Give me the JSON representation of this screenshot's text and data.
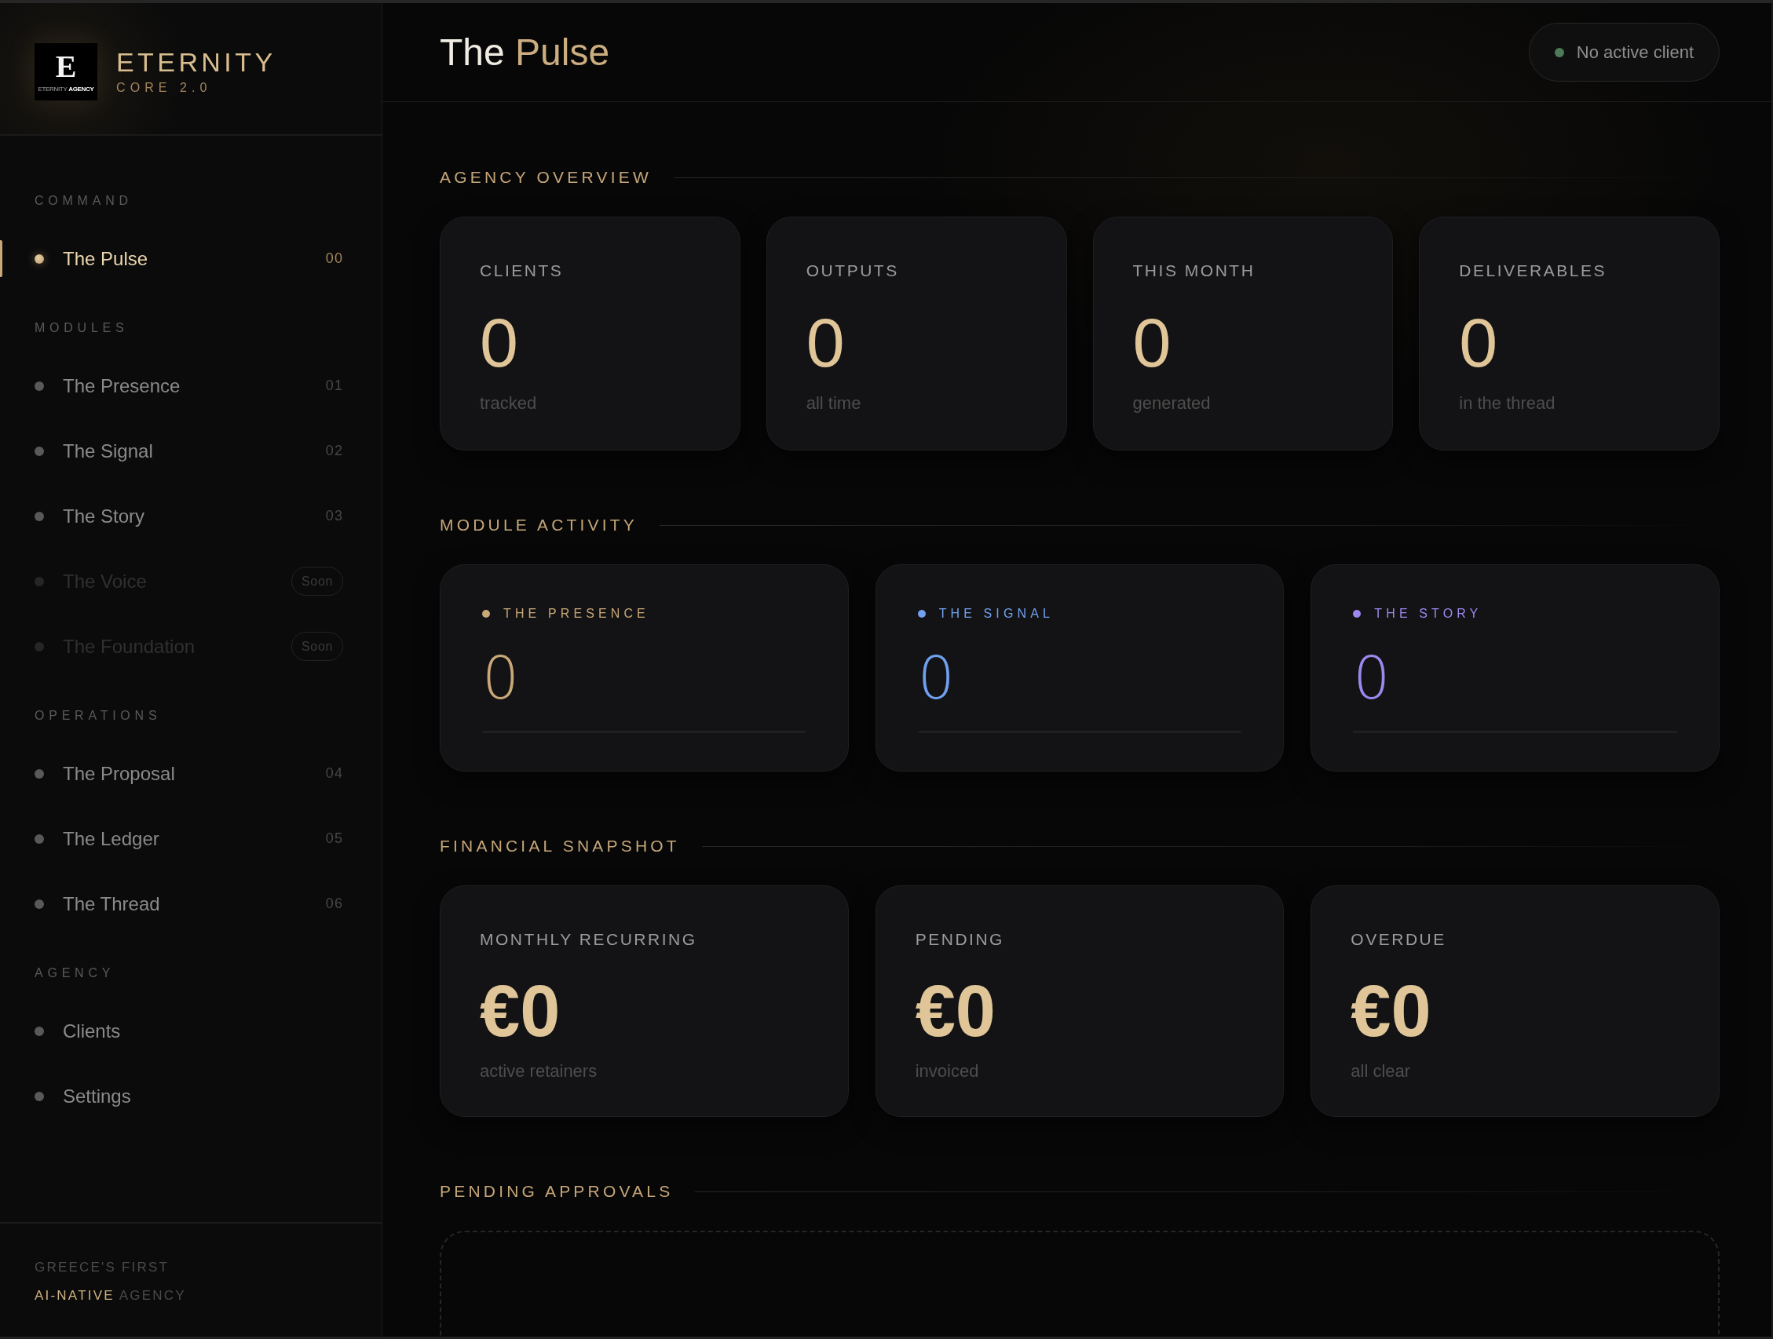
{
  "sidebar": {
    "brand": {
      "logo_mark": "E",
      "logo_caption": "ETERNITY **AGENCY**",
      "name": "ETERNITY",
      "version": "CORE 2.0"
    },
    "sections": [
      {
        "heading": "COMMAND",
        "items": [
          {
            "label": "The Pulse",
            "number": "00",
            "selected": true,
            "disabled": false
          }
        ]
      },
      {
        "heading": "MODULES",
        "items": [
          {
            "label": "The Presence",
            "number": "01",
            "selected": false,
            "disabled": false
          },
          {
            "label": "The Signal",
            "number": "02",
            "selected": false,
            "disabled": false
          },
          {
            "label": "The Story",
            "number": "03",
            "selected": false,
            "disabled": false
          },
          {
            "label": "The Voice",
            "badge": "Soon",
            "selected": false,
            "disabled": true
          },
          {
            "label": "The Foundation",
            "badge": "Soon",
            "selected": false,
            "disabled": true
          }
        ]
      },
      {
        "heading": "OPERATIONS",
        "items": [
          {
            "label": "The Proposal",
            "number": "04",
            "selected": false,
            "disabled": false
          },
          {
            "label": "The Ledger",
            "number": "05",
            "selected": false,
            "disabled": false
          },
          {
            "label": "The Thread",
            "number": "06",
            "selected": false,
            "disabled": false
          }
        ]
      },
      {
        "heading": "AGENCY",
        "items": [
          {
            "label": "Clients",
            "selected": false,
            "disabled": false
          },
          {
            "label": "Settings",
            "selected": false,
            "disabled": false
          }
        ]
      }
    ],
    "tagline": {
      "line_1": "GREECE'S FIRST",
      "line_2_accent": "AI-NATIVE",
      "line_2_rest": "AGENCY"
    }
  },
  "header": {
    "title": {
      "plain": "The",
      "accent": "Pulse"
    },
    "client_status": "No active client"
  },
  "agency_overview": {
    "title": "AGENCY OVERVIEW",
    "stats": [
      {
        "label": "CLIENTS",
        "value": "0",
        "caption": "tracked"
      },
      {
        "label": "OUTPUTS",
        "value": "0",
        "caption": "all time"
      },
      {
        "label": "THIS MONTH",
        "value": "0",
        "caption": "generated"
      },
      {
        "label": "DELIVERABLES",
        "value": "0",
        "caption": "in the thread"
      }
    ]
  },
  "module_activity": {
    "title": "MODULE ACTIVITY",
    "modules": [
      {
        "name": "THE PRESENCE",
        "color": "#c9a878",
        "value": "0",
        "level": 0
      },
      {
        "name": "THE SIGNAL",
        "color": "#6fa1ee",
        "value": "0",
        "level": 0
      },
      {
        "name": "THE STORY",
        "color": "#9d88ee",
        "value": "0",
        "level": 0
      }
    ]
  },
  "financial_snapshot": {
    "title": "FINANCIAL SNAPSHOT",
    "figures": [
      {
        "label": "MONTHLY RECURRING",
        "value": "€0",
        "caption": "active retainers"
      },
      {
        "label": "PENDING",
        "value": "€0",
        "caption": "invoiced"
      },
      {
        "label": "OVERDUE",
        "value": "€0",
        "caption": "all clear"
      }
    ]
  },
  "pending_approvals": {
    "title": "PENDING APPROVALS"
  }
}
